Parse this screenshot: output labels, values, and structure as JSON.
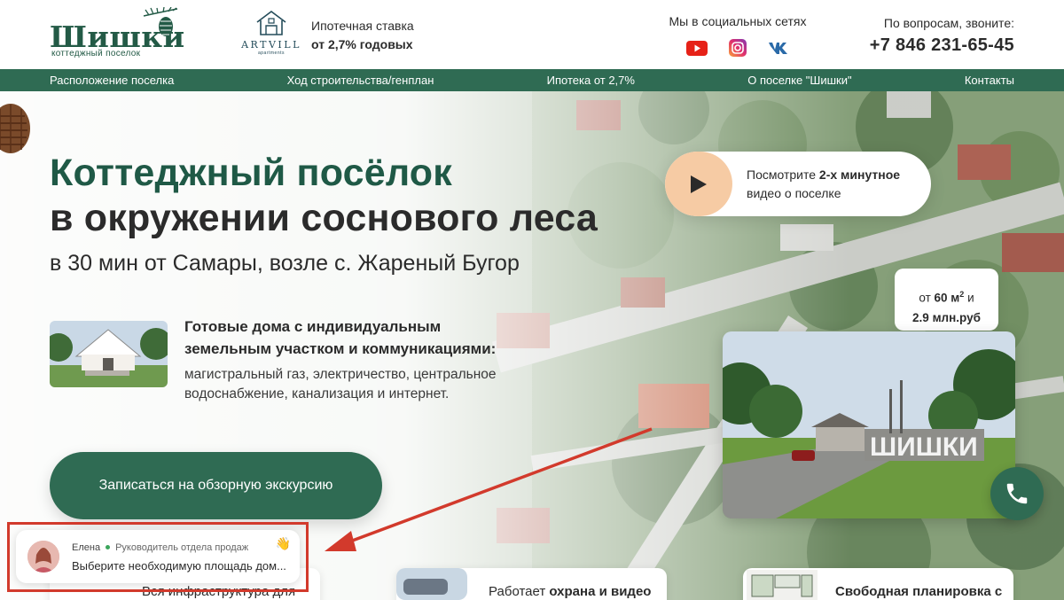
{
  "header": {
    "logo": {
      "word": "Шишки",
      "sub": "коттеджный поселок"
    },
    "partner": {
      "name": "ARTVILL",
      "small": "apartments"
    },
    "mortgage": {
      "line1": "Ипотечная ставка",
      "line2": "от 2,7% годовых"
    },
    "social": {
      "title": "Мы в социальных сетях",
      "icons": [
        "youtube-icon",
        "instagram-icon",
        "vk-icon"
      ]
    },
    "contact": {
      "label": "По вопросам, звоните:",
      "phone": "+7 846 231-65-45"
    }
  },
  "nav": {
    "items": [
      "Расположение поселка",
      "Ход строительства/генплан",
      "Ипотека от 2,7%",
      "О поселке \"Шишки\"",
      "Контакты"
    ]
  },
  "hero": {
    "title_line1": "Коттеджный посёлок",
    "title_line2": "в окружении соснового леса",
    "subtitle": "в 30 мин от Самары, возле с. Жареный Бугор",
    "feature_title": "Готовые дома с индивидуальным земельным участком и коммуникациями:",
    "feature_text": "магистральный газ, электричество, центральное водоснабжение, канализация и интернет.",
    "cta": "Записаться на обзорную экскурсию"
  },
  "video": {
    "text_prefix": "Посмотрите ",
    "text_bold": "2-х минутное",
    "text_line2": "видео о поселке"
  },
  "price": {
    "prefix": "от ",
    "area": "60 м",
    "sup": "2",
    "suffix": " и",
    "line2": "2.9 млн.руб"
  },
  "cards": [
    {
      "text": "Вся инфраструктура для"
    },
    {
      "prefix": "Работает ",
      "bold": "охрана и видео"
    },
    {
      "bold": "Свободная планировка с"
    }
  ],
  "chat": {
    "name": "Елена",
    "role": "Руководитель отдела продаж",
    "message": "Выберите необходимую площадь дом...",
    "wave": "👋"
  },
  "colors": {
    "brand_green": "#2f6b53",
    "title_green": "#1f5946",
    "highlight_red": "#d23a2c",
    "play_peach": "#f6cba4"
  }
}
